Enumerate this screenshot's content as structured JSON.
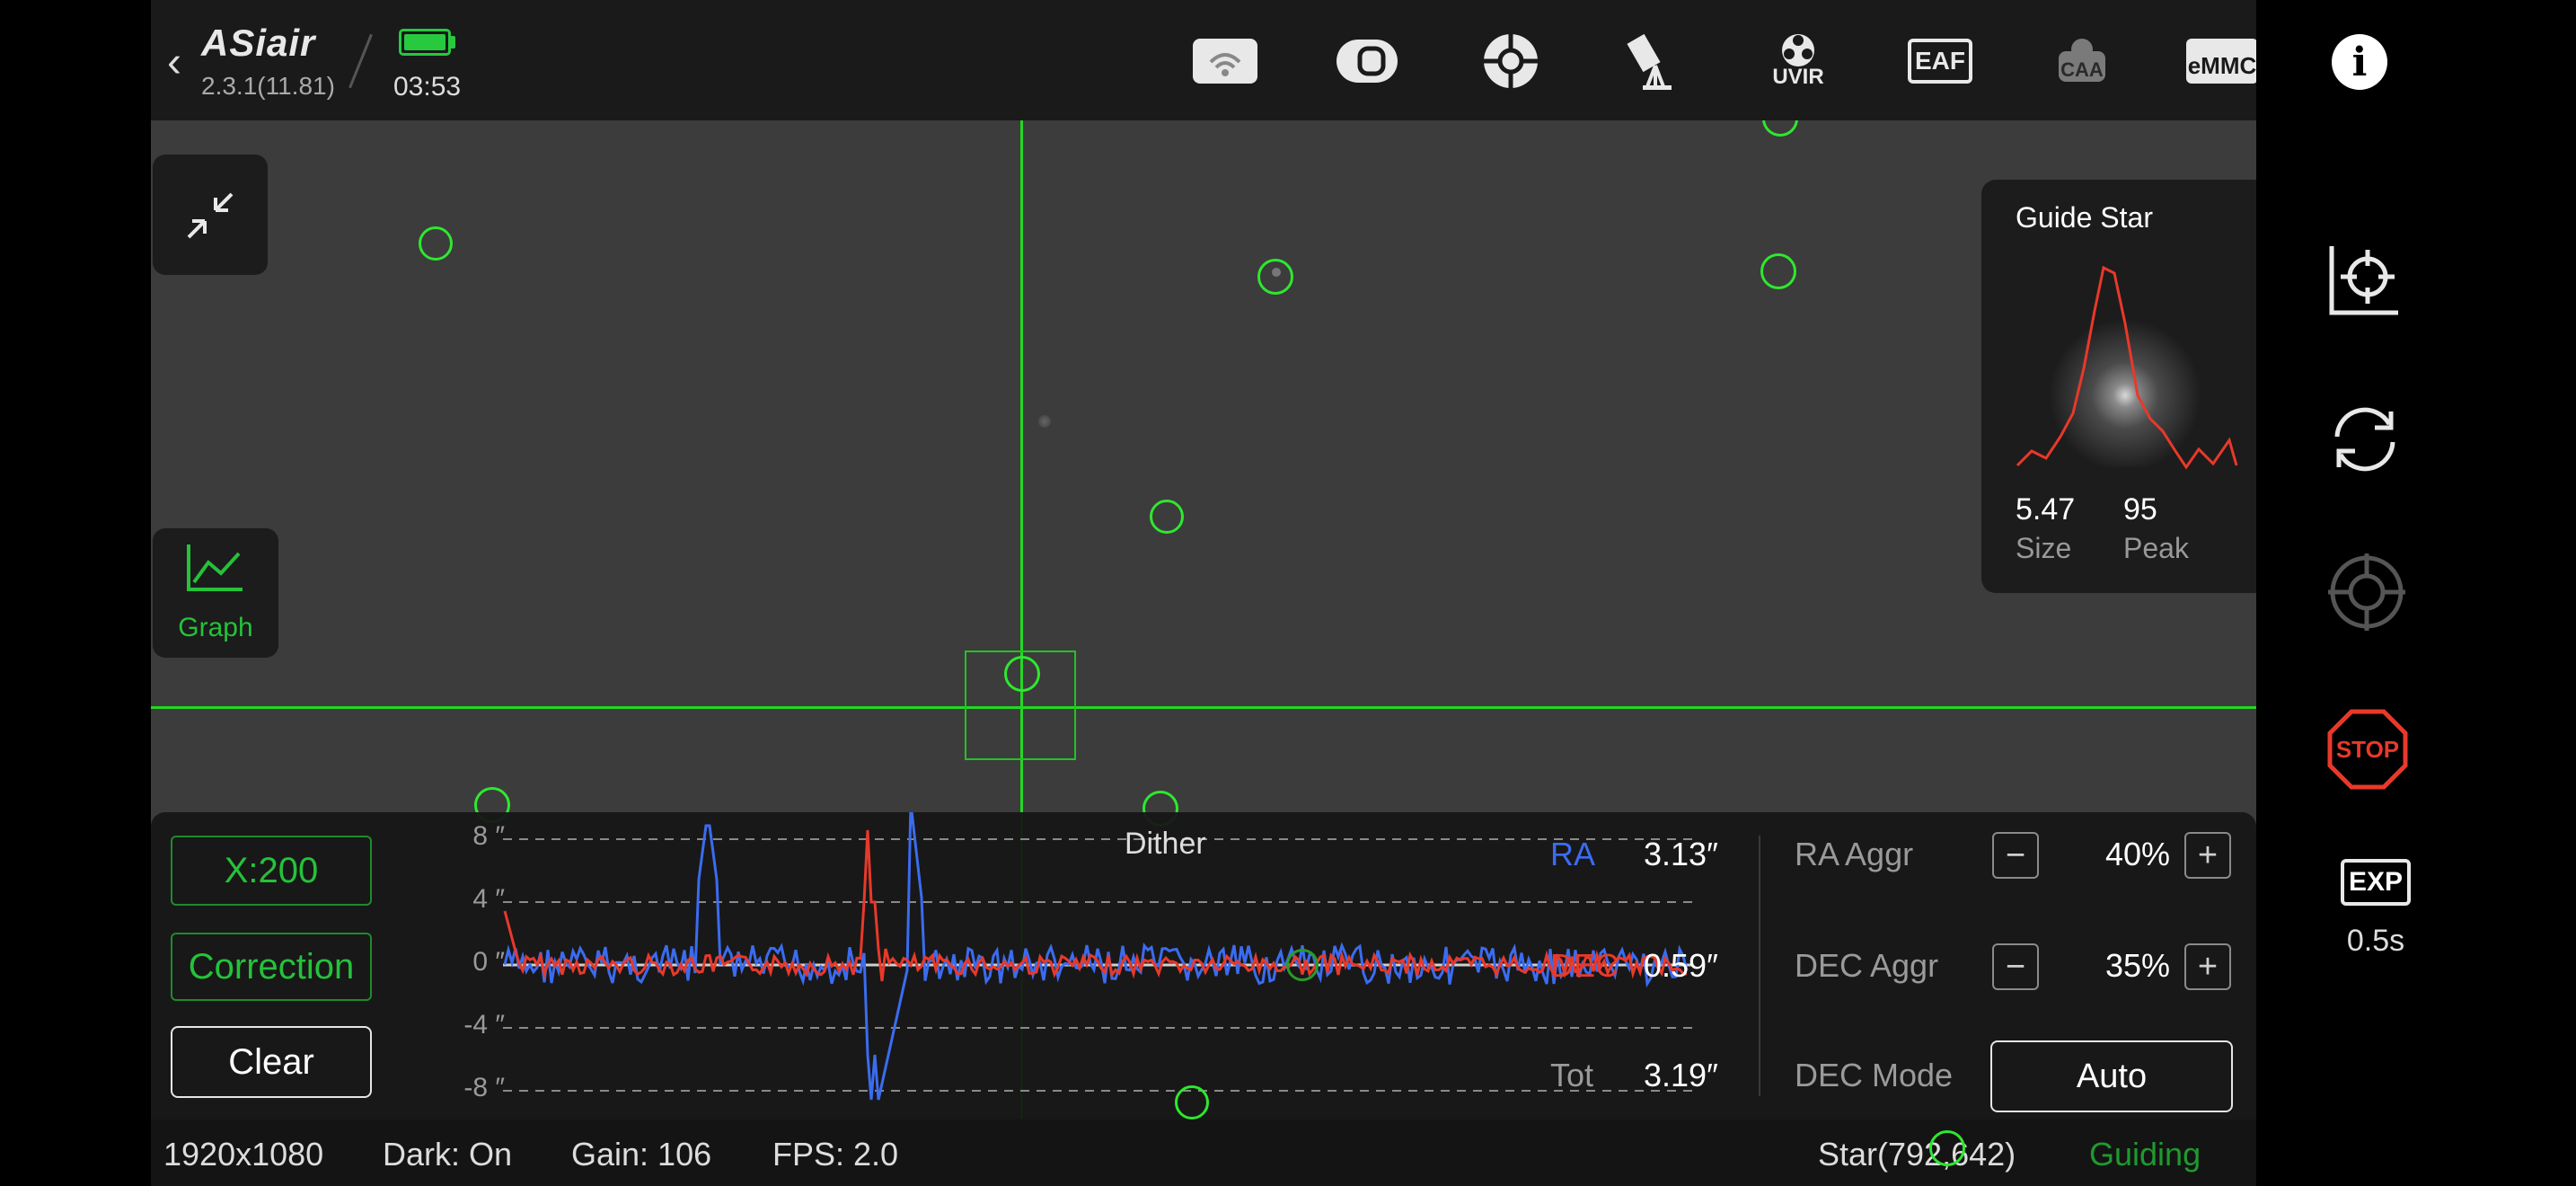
{
  "app": {
    "brand": "ASiair",
    "version": "2.3.1(11.81)",
    "time": "03:53",
    "battery_color": "#27c93f"
  },
  "toolbar": [
    {
      "name": "wifi-icon",
      "label": ""
    },
    {
      "name": "camera-icon",
      "label": ""
    },
    {
      "name": "guide-scope-icon",
      "label": ""
    },
    {
      "name": "telescope-icon",
      "label": ""
    },
    {
      "name": "filter-wheel-icon",
      "label": "UVIR"
    },
    {
      "name": "eaf-icon",
      "label": "EAF"
    },
    {
      "name": "caa-icon",
      "label": "CAA"
    },
    {
      "name": "emmc-icon",
      "label": "eMMC"
    }
  ],
  "left_panel": {
    "graph_label": "Graph"
  },
  "guide_star": {
    "title": "Guide Star",
    "size_value": "5.47",
    "size_label": "Size",
    "peak_value": "95",
    "peak_label": "Peak"
  },
  "graph": {
    "x_button": "X:200",
    "correction_button": "Correction",
    "clear_button": "Clear",
    "y_ticks": [
      "8 ″",
      "4 ″",
      "0 ″",
      "-4 ″",
      "-8 ″"
    ],
    "dither_label": "Dither",
    "ra_label": "RA",
    "ra_value": "3.13″",
    "dec_label": "DEC",
    "dec_value": "0.59″",
    "tot_label": "Tot",
    "tot_value": "3.19″",
    "ra_color": "#3b6cf0",
    "dec_color": "#e8392a"
  },
  "settings": {
    "ra_aggr_label": "RA Aggr",
    "ra_aggr_value": "40%",
    "dec_aggr_label": "DEC Aggr",
    "dec_aggr_value": "35%",
    "dec_mode_label": "DEC Mode",
    "dec_mode_value": "Auto",
    "minus": "−",
    "plus": "+"
  },
  "status": {
    "resolution": "1920x1080",
    "dark": "Dark: On",
    "gain": "Gain: 106",
    "fps": "FPS: 2.0",
    "star": "Star(792,642)",
    "state": "Guiding"
  },
  "right_bar": {
    "exp_label": "EXP",
    "exp_value": "0.5s",
    "stop_label": "STOP"
  }
}
